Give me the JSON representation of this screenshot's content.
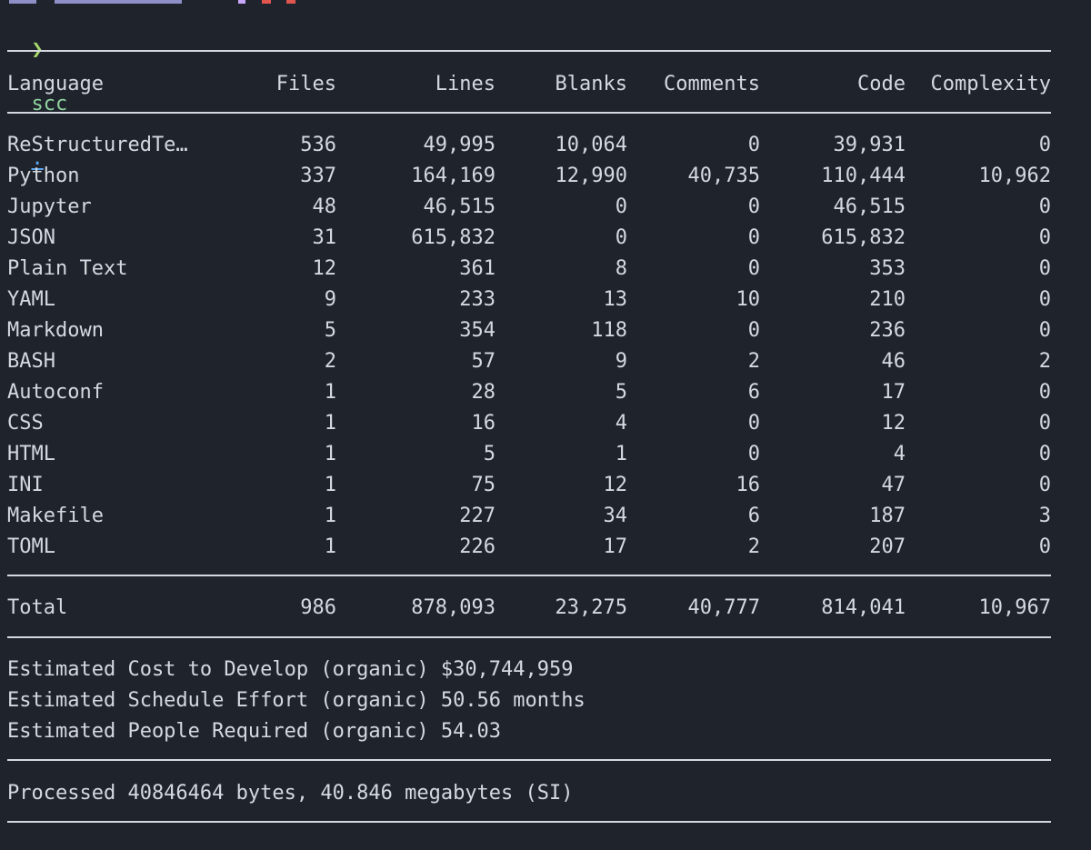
{
  "prompt": {
    "chevron": "❯",
    "command": "scc",
    "argument": "."
  },
  "colors": {
    "background": "#1f242c",
    "text": "#d5d9df",
    "prompt_chevron": "#a7d86b",
    "command": "#8fd19e",
    "argument": "#5aa7f2"
  },
  "table": {
    "headers": {
      "language": "Language",
      "files": "Files",
      "lines": "Lines",
      "blanks": "Blanks",
      "comments": "Comments",
      "code": "Code",
      "complexity": "Complexity"
    },
    "rows": [
      {
        "language": "ReStructuredTe…",
        "files": "536",
        "lines": "49,995",
        "blanks": "10,064",
        "comments": "0",
        "code": "39,931",
        "complexity": "0"
      },
      {
        "language": "Python",
        "files": "337",
        "lines": "164,169",
        "blanks": "12,990",
        "comments": "40,735",
        "code": "110,444",
        "complexity": "10,962"
      },
      {
        "language": "Jupyter",
        "files": "48",
        "lines": "46,515",
        "blanks": "0",
        "comments": "0",
        "code": "46,515",
        "complexity": "0"
      },
      {
        "language": "JSON",
        "files": "31",
        "lines": "615,832",
        "blanks": "0",
        "comments": "0",
        "code": "615,832",
        "complexity": "0"
      },
      {
        "language": "Plain Text",
        "files": "12",
        "lines": "361",
        "blanks": "8",
        "comments": "0",
        "code": "353",
        "complexity": "0"
      },
      {
        "language": "YAML",
        "files": "9",
        "lines": "233",
        "blanks": "13",
        "comments": "10",
        "code": "210",
        "complexity": "0"
      },
      {
        "language": "Markdown",
        "files": "5",
        "lines": "354",
        "blanks": "118",
        "comments": "0",
        "code": "236",
        "complexity": "0"
      },
      {
        "language": "BASH",
        "files": "2",
        "lines": "57",
        "blanks": "9",
        "comments": "2",
        "code": "46",
        "complexity": "2"
      },
      {
        "language": "Autoconf",
        "files": "1",
        "lines": "28",
        "blanks": "5",
        "comments": "6",
        "code": "17",
        "complexity": "0"
      },
      {
        "language": "CSS",
        "files": "1",
        "lines": "16",
        "blanks": "4",
        "comments": "0",
        "code": "12",
        "complexity": "0"
      },
      {
        "language": "HTML",
        "files": "1",
        "lines": "5",
        "blanks": "1",
        "comments": "0",
        "code": "4",
        "complexity": "0"
      },
      {
        "language": "INI",
        "files": "1",
        "lines": "75",
        "blanks": "12",
        "comments": "16",
        "code": "47",
        "complexity": "0"
      },
      {
        "language": "Makefile",
        "files": "1",
        "lines": "227",
        "blanks": "34",
        "comments": "6",
        "code": "187",
        "complexity": "3"
      },
      {
        "language": "TOML",
        "files": "1",
        "lines": "226",
        "blanks": "17",
        "comments": "2",
        "code": "207",
        "complexity": "0"
      }
    ],
    "total": {
      "language": "Total",
      "files": "986",
      "lines": "878,093",
      "blanks": "23,275",
      "comments": "40,777",
      "code": "814,041",
      "complexity": "10,967"
    }
  },
  "estimates": [
    "Estimated Cost to Develop (organic) $30,744,959",
    "Estimated Schedule Effort (organic) 50.56 months",
    "Estimated People Required (organic) 54.03"
  ],
  "processed": "Processed 40846464 bytes, 40.846 megabytes (SI)"
}
